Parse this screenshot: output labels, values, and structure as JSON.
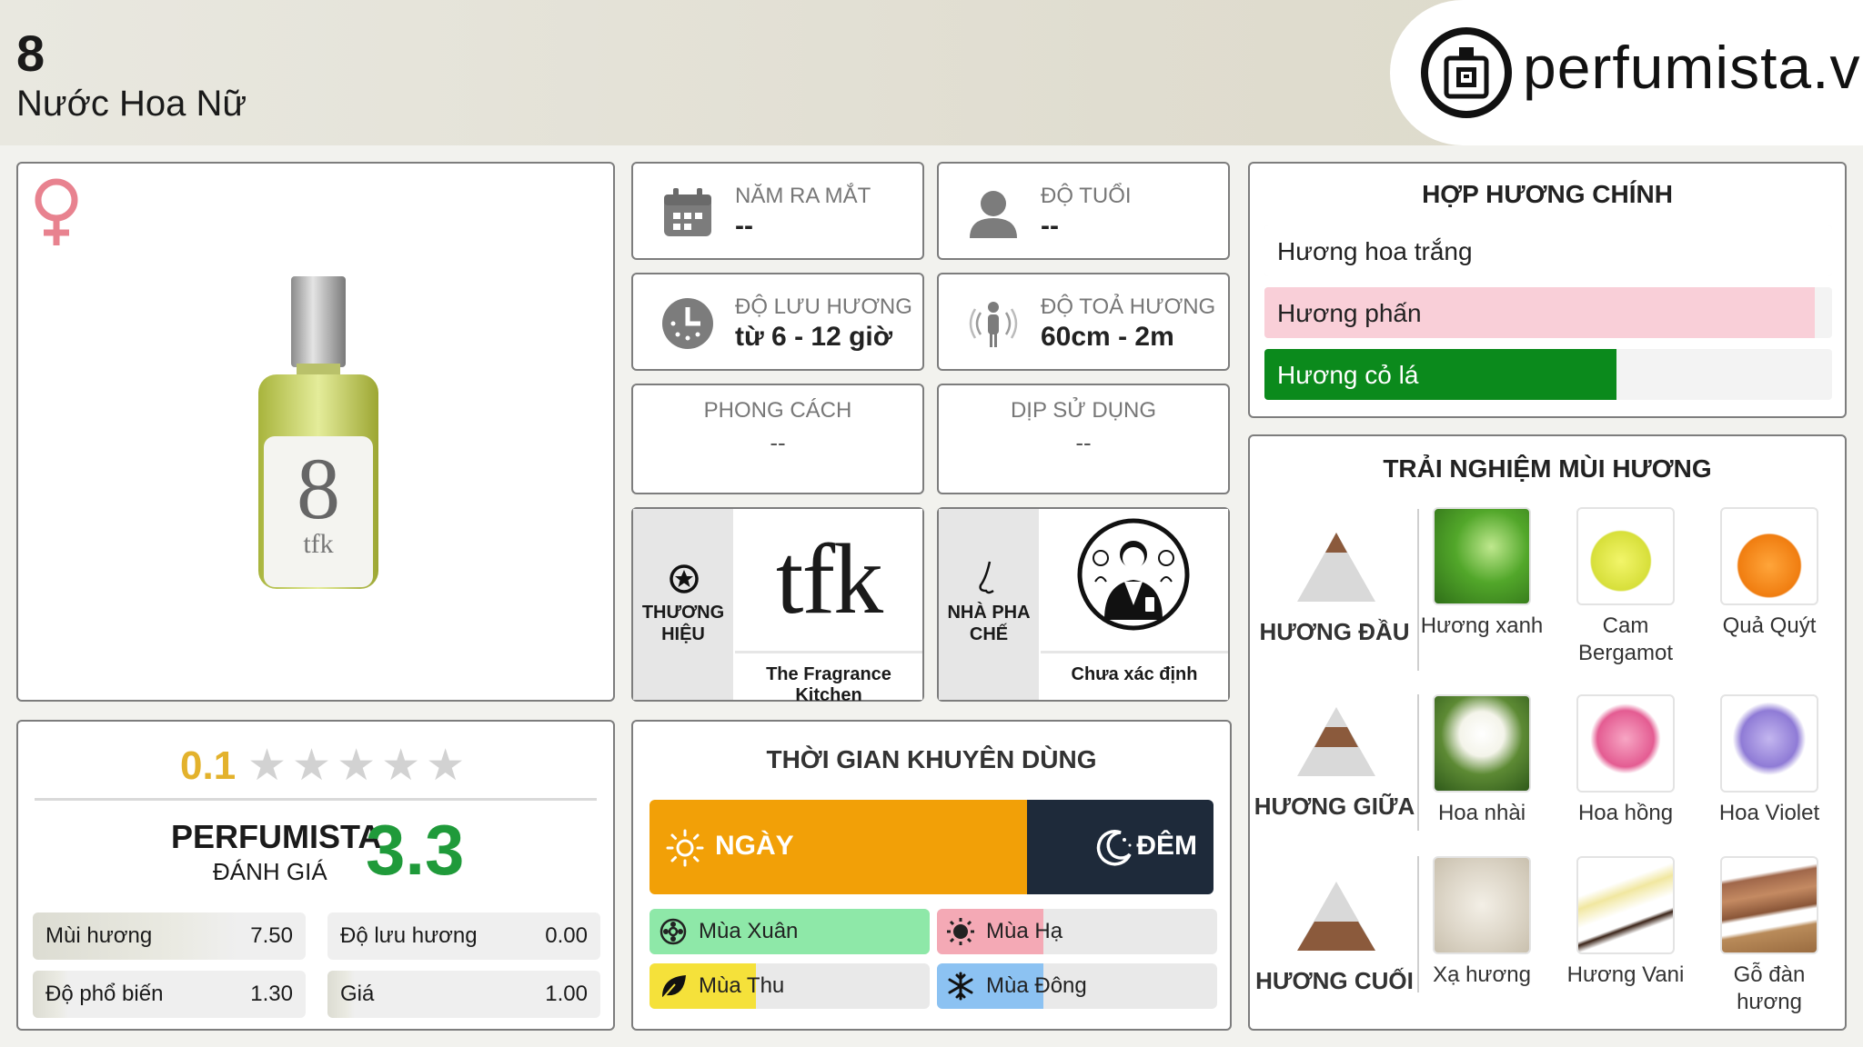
{
  "header": {
    "title": "8",
    "subtitle": "Nước Hoa Nữ",
    "logo_text": "perfumista.vn"
  },
  "product": {
    "gender_icon": "female-symbol-icon",
    "bottle_number": "8",
    "bottle_brand": "tfk"
  },
  "rating": {
    "user_score": "0.1",
    "stars_total": 5,
    "brand": "PERFUMISTA",
    "eval_label": "ĐÁNH GIÁ",
    "score": "3.3",
    "metrics": [
      {
        "label": "Mùi hương",
        "value": "7.50",
        "fraction": 0.75
      },
      {
        "label": "Độ lưu hương",
        "value": "0.00",
        "fraction": 0.0
      },
      {
        "label": "Độ phổ biến",
        "value": "1.30",
        "fraction": 0.13
      },
      {
        "label": "Giá",
        "value": "1.00",
        "fraction": 0.1
      }
    ]
  },
  "info": {
    "release": {
      "label": "NĂM RA MẮT",
      "value": "--",
      "icon": "calendar-icon"
    },
    "age": {
      "label": "ĐỘ TUỔI",
      "value": "--",
      "icon": "person-icon"
    },
    "longevity": {
      "label": "ĐỘ LƯU HƯƠNG",
      "value": "từ 6 - 12 giờ",
      "icon": "clock-icon"
    },
    "sillage": {
      "label": "ĐỘ TOẢ HƯƠNG",
      "value": "60cm - 2m",
      "icon": "sillage-icon"
    },
    "style": {
      "label": "PHONG CÁCH",
      "value": "--"
    },
    "occasion": {
      "label": "DỊP SỬ DỤNG",
      "value": "--"
    }
  },
  "brand": {
    "side_label": "THƯƠNG HIỆU",
    "logo": "tfk",
    "name": "The Fragrance Kitchen"
  },
  "perfumer": {
    "side_label": "NHÀ PHA CHẾ",
    "name": "Chưa xác định"
  },
  "time": {
    "title": "THỜI GIAN KHUYÊN DÙNG",
    "day_label": "NGÀY",
    "night_label": "ĐÊM",
    "day_fraction": 0.67,
    "seasons": [
      {
        "label": "Mùa Xuân",
        "fraction": 1.0,
        "color": "#8ee8a8",
        "icon": "flower-icon"
      },
      {
        "label": "Mùa Hạ",
        "fraction": 0.38,
        "color": "#f4a9b5",
        "icon": "sun-icon"
      },
      {
        "label": "Mùa Thu",
        "fraction": 0.38,
        "color": "#f5e13a",
        "icon": "leaf-icon"
      },
      {
        "label": "Mùa Đông",
        "fraction": 0.38,
        "color": "#8cc2f2",
        "icon": "snowflake-icon"
      }
    ]
  },
  "accords": {
    "title": "HỢP HƯƠNG CHÍNH",
    "items": [
      {
        "label": "Hương hoa trắng",
        "fraction": 1.0,
        "color": "#ffffff",
        "text_color": "#222222"
      },
      {
        "label": "Hương phấn",
        "fraction": 0.97,
        "color": "#f9cfd8",
        "text_color": "#222222"
      },
      {
        "label": "Hương cỏ lá",
        "fraction": 0.62,
        "color": "#0b8a1c",
        "text_color": "#ffffff"
      }
    ]
  },
  "notes": {
    "title": "TRẢI NGHIỆM MÙI HƯƠNG",
    "tiers": [
      {
        "label": "HƯƠNG ĐẦU",
        "items": [
          "Hương xanh",
          "Cam Bergamot",
          "Quả Quýt"
        ]
      },
      {
        "label": "HƯƠNG GIỮA",
        "items": [
          "Hoa nhài",
          "Hoa hồng",
          "Hoa Violet"
        ]
      },
      {
        "label": "HƯƠNG CUỐI",
        "items": [
          "Xạ hương",
          "Hương Vani",
          "Gỗ đàn hương"
        ]
      }
    ]
  }
}
